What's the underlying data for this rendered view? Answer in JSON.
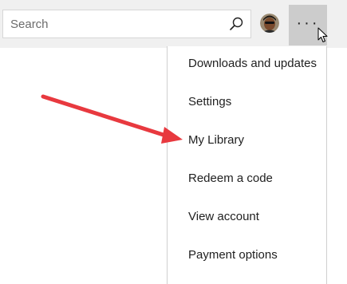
{
  "search": {
    "placeholder": "Search"
  },
  "icons": {
    "search": "search-icon",
    "more": "more-icon",
    "cursor": "pointer-cursor-icon"
  },
  "more_button": {
    "label": "···"
  },
  "menu": {
    "items": [
      {
        "label": "Downloads and updates"
      },
      {
        "label": "Settings"
      },
      {
        "label": "My Library"
      },
      {
        "label": "Redeem a code"
      },
      {
        "label": "View account"
      },
      {
        "label": "Payment options"
      }
    ]
  },
  "annotation": {
    "arrow_color": "#e8393f",
    "points_to": "My Library"
  }
}
